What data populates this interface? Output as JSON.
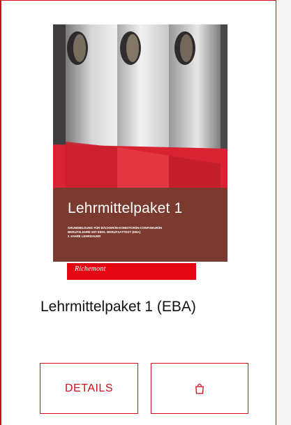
{
  "product": {
    "title": "Lehrmittelpaket 1 (EBA)",
    "cover": {
      "title": "Lehrmittelpaket 1",
      "subtitle": "GRUNDBILDUNG FÜR BÄCKER/IN-KONDITOR/IN-CONFISEUR/IN\nBERUFSLEHRE MIT EIDG. BERUFSATTEST (EBA)\n2 JAHRE LEHRDAUER",
      "brand": "Richemont"
    }
  },
  "actions": {
    "details_label": "DETAILS",
    "cart_icon": "shopping-bag-icon"
  },
  "colors": {
    "accent": "#d40b1c",
    "cover_band": "#7b3a2f",
    "brand_red": "#e30613"
  }
}
